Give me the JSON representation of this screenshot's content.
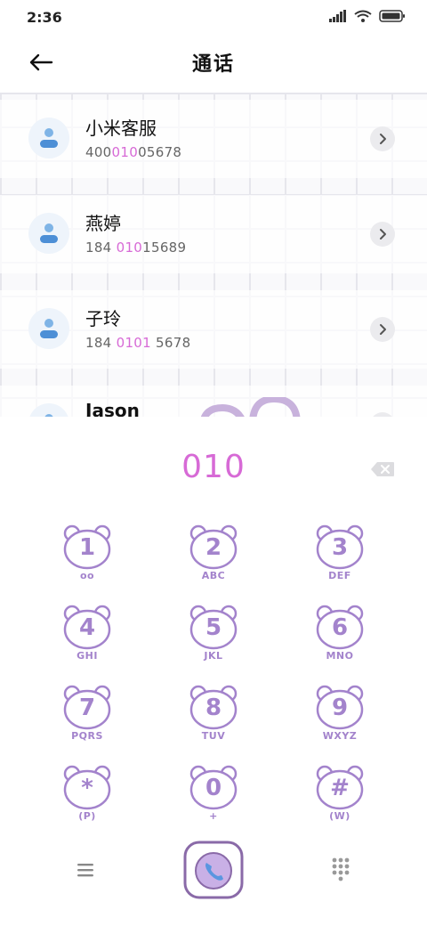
{
  "status_bar": {
    "time": "2:36"
  },
  "header": {
    "title": "通话"
  },
  "contacts": [
    {
      "name": "小米客服",
      "number_pre": "400",
      "number_match": "010",
      "number_post": "05678"
    },
    {
      "name": "燕婷",
      "number_pre": "184 ",
      "number_match": "010",
      "number_post": "15689"
    },
    {
      "name": "子玲",
      "number_pre": "184 ",
      "number_match": "0101",
      "number_post": " 5678"
    },
    {
      "name": "Jason",
      "number_pre": "",
      "number_match": "",
      "number_post": ""
    }
  ],
  "dialer": {
    "display": "010",
    "keys": [
      {
        "digit": "1",
        "letters": "oo"
      },
      {
        "digit": "2",
        "letters": "ABC"
      },
      {
        "digit": "3",
        "letters": "DEF"
      },
      {
        "digit": "4",
        "letters": "GHI"
      },
      {
        "digit": "5",
        "letters": "JKL"
      },
      {
        "digit": "6",
        "letters": "MNO"
      },
      {
        "digit": "7",
        "letters": "PQRS"
      },
      {
        "digit": "8",
        "letters": "TUV"
      },
      {
        "digit": "9",
        "letters": "WXYZ"
      },
      {
        "digit": "*",
        "letters": "(P)"
      },
      {
        "digit": "0",
        "letters": "+"
      },
      {
        "digit": "#",
        "letters": "(W)"
      }
    ]
  },
  "colors": {
    "accent": "#d76ad6",
    "key_purple": "#a383cc",
    "call_border": "#8a6aa8",
    "call_fill": "#c9b0e6"
  },
  "icons": {
    "back": "arrow-left-icon",
    "contact_avatar": "person-icon",
    "chevron": "chevron-right-icon",
    "backspace": "backspace-icon",
    "menu": "menu-icon",
    "call": "phone-icon",
    "dialpad": "dialpad-icon"
  }
}
